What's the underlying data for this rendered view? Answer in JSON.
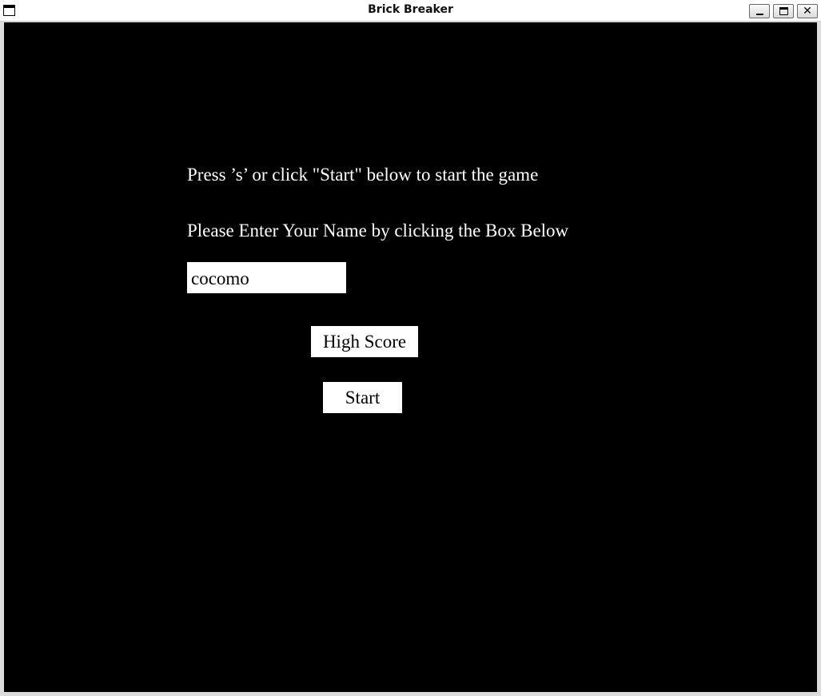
{
  "window": {
    "title": "Brick Breaker",
    "icon": "window-icon",
    "controls": {
      "minimize": "minimize-icon",
      "maximize": "maximize-icon",
      "close": "✕"
    }
  },
  "menu": {
    "instruction": "Press ’s’ or click \"Start\" below to start the game",
    "name_prompt": "Please Enter Your Name by clicking the Box Below",
    "name_value": "cocomo",
    "high_score_label": "High Score",
    "start_label": "Start"
  },
  "colors": {
    "background": "#000000",
    "text": "#ffffff",
    "button_bg": "#ffffff",
    "button_text": "#000000"
  }
}
